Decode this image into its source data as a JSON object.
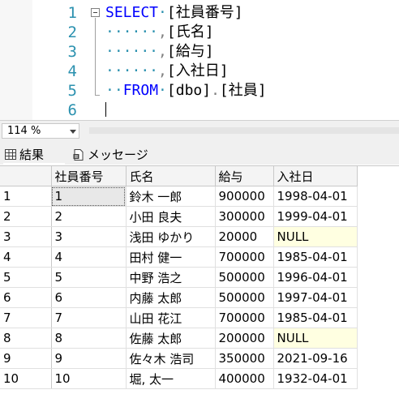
{
  "editor": {
    "line_numbers": [
      "1",
      "2",
      "3",
      "4",
      "5",
      "6"
    ],
    "lines": [
      {
        "parts": [
          {
            "t": "SELECT",
            "c": "kw"
          },
          {
            "t": "·",
            "c": "ws"
          },
          {
            "t": "[社員番号]",
            "c": ""
          }
        ]
      },
      {
        "parts": [
          {
            "t": "······",
            "c": "ws"
          },
          {
            "t": ",",
            "c": "gray"
          },
          {
            "t": "[氏名]",
            "c": ""
          }
        ]
      },
      {
        "parts": [
          {
            "t": "······",
            "c": "ws"
          },
          {
            "t": ",",
            "c": "gray"
          },
          {
            "t": "[給与]",
            "c": ""
          }
        ]
      },
      {
        "parts": [
          {
            "t": "······",
            "c": "ws"
          },
          {
            "t": ",",
            "c": "gray"
          },
          {
            "t": "[入社日]",
            "c": ""
          }
        ]
      },
      {
        "parts": [
          {
            "t": "··",
            "c": "ws"
          },
          {
            "t": "FROM",
            "c": "kw"
          },
          {
            "t": "·",
            "c": "ws"
          },
          {
            "t": "[dbo]",
            "c": ""
          },
          {
            "t": ".",
            "c": "gray"
          },
          {
            "t": "[社員]",
            "c": ""
          }
        ]
      },
      {
        "parts": []
      }
    ]
  },
  "statusbar": {
    "zoom": "114 %"
  },
  "tabs": {
    "results": "結果",
    "messages": "メッセージ"
  },
  "grid": {
    "columns": [
      "社員番号",
      "氏名",
      "給与",
      "入社日"
    ],
    "rows": [
      {
        "n": "1",
        "cells": [
          "1",
          "鈴木 一郎",
          "900000",
          "1998-04-01"
        ]
      },
      {
        "n": "2",
        "cells": [
          "2",
          "小田 良夫",
          "300000",
          "1999-04-01"
        ]
      },
      {
        "n": "3",
        "cells": [
          "3",
          "浅田 ゆかり",
          "20000",
          "NULL"
        ]
      },
      {
        "n": "4",
        "cells": [
          "4",
          "田村 健一",
          "700000",
          "1985-04-01"
        ]
      },
      {
        "n": "5",
        "cells": [
          "5",
          "中野 浩之",
          "500000",
          "1996-04-01"
        ]
      },
      {
        "n": "6",
        "cells": [
          "6",
          "内藤 太郎",
          "500000",
          "1997-04-01"
        ]
      },
      {
        "n": "7",
        "cells": [
          "7",
          "山田 花江",
          "700000",
          "1985-04-01"
        ]
      },
      {
        "n": "8",
        "cells": [
          "8",
          "佐藤 太郎",
          "200000",
          "NULL"
        ]
      },
      {
        "n": "9",
        "cells": [
          "9",
          "佐々木 浩司",
          "350000",
          "2021-09-16"
        ]
      },
      {
        "n": "10",
        "cells": [
          "10",
          "堀, 太一",
          "400000",
          "1932-04-01"
        ]
      }
    ],
    "null_color": "#ffffe1"
  }
}
